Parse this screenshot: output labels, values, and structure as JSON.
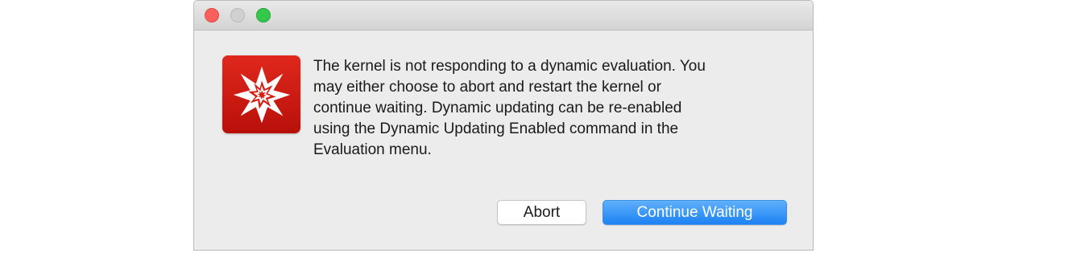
{
  "window": {
    "traffic_lights": [
      "close",
      "minimize",
      "zoom"
    ]
  },
  "dialog": {
    "icon": "wolfram-mathematica-spikey-icon",
    "message": "The kernel is not responding to a dynamic evaluation.  You\nmay either choose to abort and restart the kernel or\ncontinue waiting.  Dynamic updating can be re-enabled\nusing the Dynamic Updating Enabled command in the\nEvaluation menu.",
    "buttons": {
      "abort_label": "Abort",
      "continue_label": "Continue Waiting"
    }
  },
  "colors": {
    "close": "#fc605c",
    "minimize": "#d0d0d0",
    "zoom": "#34c84a",
    "icon_red": "#d41f16",
    "default_button_blue": "#1d82f4"
  }
}
